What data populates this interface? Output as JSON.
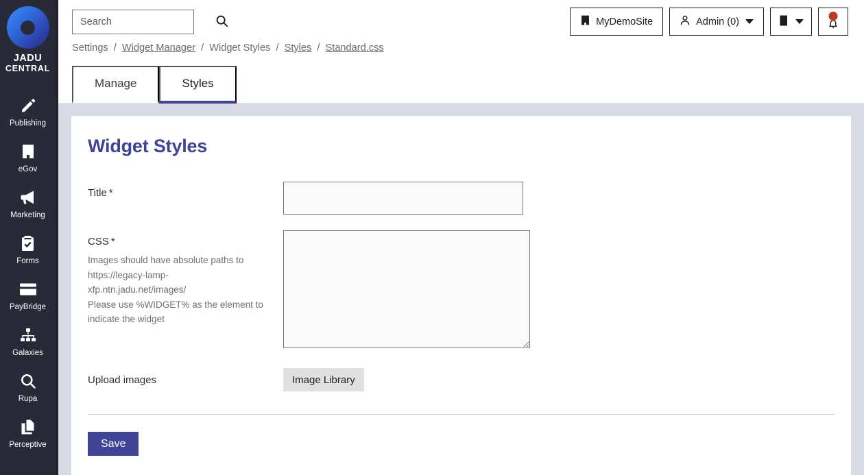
{
  "brand": {
    "line1": "JADU",
    "line2": "CENTRAL",
    "logo_icon": "circle-ring-logo"
  },
  "sidebar": {
    "items": [
      {
        "label": "Publishing",
        "icon": "pencil-icon"
      },
      {
        "label": "eGov",
        "icon": "building-icon"
      },
      {
        "label": "Marketing",
        "icon": "megaphone-icon"
      },
      {
        "label": "Forms",
        "icon": "clipboard-check-icon"
      },
      {
        "label": "PayBridge",
        "icon": "credit-card-icon"
      },
      {
        "label": "Galaxies",
        "icon": "sitemap-icon"
      },
      {
        "label": "Rupa",
        "icon": "magnifier-icon"
      },
      {
        "label": "Perceptive",
        "icon": "documents-icon"
      }
    ]
  },
  "header": {
    "search_placeholder": "Search",
    "search_value": "",
    "search_icon": "search-icon",
    "site_button": {
      "label": "MyDemoSite",
      "icon": "building-icon"
    },
    "admin_button": {
      "label": "Admin (0)",
      "icon": "user-icon",
      "caret": "chevron-down-icon"
    },
    "book_button": {
      "icon": "book-icon",
      "caret": "chevron-down-icon"
    },
    "bell_button": {
      "icon": "bell-icon",
      "badge": true
    }
  },
  "breadcrumb": {
    "items": [
      {
        "label": "Settings",
        "link": false
      },
      {
        "label": "Widget Manager",
        "link": true
      },
      {
        "label": "Widget Styles",
        "link": false
      },
      {
        "label": "Styles",
        "link": true
      },
      {
        "label": "Standard.css",
        "link": true
      }
    ],
    "separator": "/"
  },
  "tabs": [
    {
      "label": "Manage",
      "active": false
    },
    {
      "label": "Styles",
      "active": true
    }
  ],
  "page": {
    "title": "Widget Styles"
  },
  "form": {
    "title_field": {
      "label": "Title",
      "required_marker": "*",
      "value": "",
      "placeholder": ""
    },
    "css_field": {
      "label": "CSS",
      "required_marker": "*",
      "hint_line1": "Images should have absolute paths to",
      "hint_line2": "https://legacy-lamp-",
      "hint_line3": "xfp.ntn.jadu.net/images/",
      "hint_line4": "Please use %WIDGET% as the element to",
      "hint_line5": "indicate the widget",
      "value": "",
      "placeholder": ""
    },
    "upload_field": {
      "label": "Upload images",
      "button_label": "Image Library"
    },
    "save_label": "Save"
  },
  "colors": {
    "sidebar_bg": "#282a38",
    "page_bg": "#d8dae6",
    "accent_indigo": "#3f4496",
    "badge_red": "#c0392b",
    "field_bg": "#fafafa",
    "field_border": "#767676",
    "button_gray": "#e0e0e0"
  }
}
